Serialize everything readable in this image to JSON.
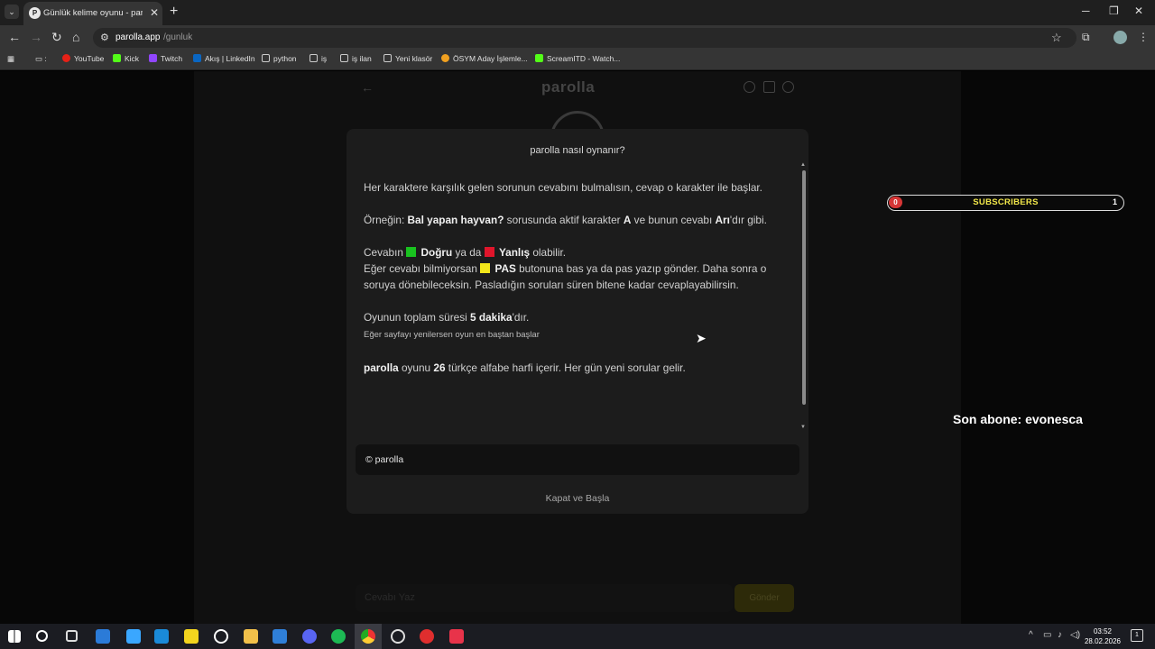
{
  "browser": {
    "tab_title": "Günlük kelime oyunu - parolla",
    "url_host": "parolla.app",
    "url_path": "/gunluk",
    "bookmarks": [
      "YouTube",
      "Kick",
      "Twitch",
      "Akış | LinkedIn",
      "python",
      "iş",
      "iş ilan",
      "Yeni klasör",
      "ÖSYM Aday İşlemle...",
      "ScreamITD - Watch..."
    ]
  },
  "site": {
    "logo": "parolla",
    "answer_placeholder": "Cevabı Yaz",
    "submit_label": "Gönder"
  },
  "modal": {
    "title": "parolla nasıl oynanır?",
    "p1": "Her karaktere karşılık gelen sorunun cevabını bulmalısın, cevap o karakter ile başlar.",
    "p2_prefix": "Örneğin: ",
    "p2_question": "Bal yapan hayvan?",
    "p2_mid": " sorusunda aktif karakter ",
    "p2_letter": "A",
    "p2_mid2": " ve bunun cevabı ",
    "p2_answer": "Arı",
    "p2_suffix": "'dır gibi.",
    "p3_a": "Cevabın ",
    "p3_correct": "Doğru",
    "p3_b": " ya da ",
    "p3_wrong": "Yanlış",
    "p3_c": " olabilir.",
    "p3_d": "Eğer cevabı bilmiyorsan ",
    "p3_pass": "PAS",
    "p3_e": " butonuna bas ya da pas yazıp gönder. Daha sonra o soruya dönebileceksin. Pasladığın soruları süren bitene kadar cevaplayabilirsin.",
    "p4_a": "Oyunun toplam süresi ",
    "p4_time": "5 dakika",
    "p4_b": "'dır.",
    "p4_small": "Eğer sayfayı yenilersen oyun en baştan başlar",
    "p5_name": "parolla",
    "p5_a": " oyunu ",
    "p5_count": "26",
    "p5_b": " türkçe alfabe harfi içerir. Her gün yeni sorular gelir.",
    "copyright": "© parolla",
    "close_start": "Kapat ve Başla"
  },
  "overlay": {
    "subs_count": "0",
    "subs_label": "SUBSCRIBERS",
    "subs_goal": "1",
    "last_sub": "Son abone: evonesca"
  },
  "taskbar": {
    "time": "03:52",
    "date": "28.02.2026",
    "notif_count": "1"
  },
  "colors": {
    "correct": "#19c21f",
    "wrong": "#e0152b",
    "pass": "#f2e61a",
    "subs_accent": "#f3e84a"
  }
}
